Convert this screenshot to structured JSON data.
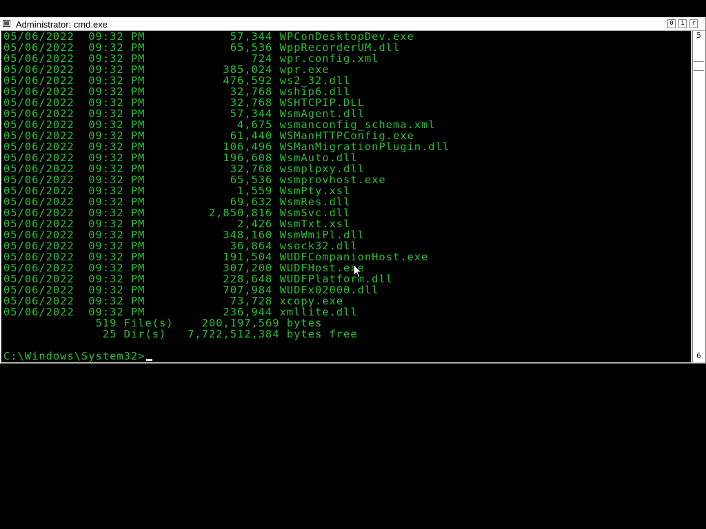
{
  "window": {
    "title": "Administrator: cmd.exe",
    "buttons": {
      "minimize": "0",
      "maximize": "1",
      "close": "r"
    }
  },
  "scrollbar": {
    "up_arrow": "5",
    "down_arrow": "6"
  },
  "console": {
    "text_color": "#25c230",
    "background_color": "#000000",
    "lines": [
      "05/06/2022  09:32 PM            57,344 WPConDesktopDev.exe",
      "05/06/2022  09:32 PM            65,536 WppRecorderUM.dll",
      "05/06/2022  09:32 PM               724 wpr.config.xml",
      "05/06/2022  09:32 PM           385,024 wpr.exe",
      "05/06/2022  09:32 PM           476,592 ws2_32.dll",
      "05/06/2022  09:32 PM            32,768 wship6.dll",
      "05/06/2022  09:32 PM            32,768 WSHTCPIP.DLL",
      "05/06/2022  09:32 PM            57,344 WsmAgent.dll",
      "05/06/2022  09:32 PM             4,675 wsmanconfig_schema.xml",
      "05/06/2022  09:32 PM            61,440 WSManHTTPConfig.exe",
      "05/06/2022  09:32 PM           106,496 WSManMigrationPlugin.dll",
      "05/06/2022  09:32 PM           196,608 WsmAuto.dll",
      "05/06/2022  09:32 PM            32,768 wsmplpxy.dll",
      "05/06/2022  09:32 PM            65,536 wsmprovhost.exe",
      "05/06/2022  09:32 PM             1,559 WsmPty.xsl",
      "05/06/2022  09:32 PM            69,632 WsmRes.dll",
      "05/06/2022  09:32 PM         2,850,816 WsmSvc.dll",
      "05/06/2022  09:32 PM             2,426 WsmTxt.xsl",
      "05/06/2022  09:32 PM           348,160 WsmWmiPl.dll",
      "05/06/2022  09:32 PM            36,864 wsock32.dll",
      "05/06/2022  09:32 PM           191,504 WUDFCompanionHost.exe",
      "05/06/2022  09:32 PM           307,200 WUDFHost.exe",
      "05/06/2022  09:32 PM           228,648 WUDFPlatform.dll",
      "05/06/2022  09:32 PM           707,984 WUDFx02000.dll",
      "05/06/2022  09:32 PM            73,728 xcopy.exe",
      "05/06/2022  09:32 PM           236,944 xmllite.dll",
      "             519 File(s)    200,197,569 bytes",
      "              25 Dir(s)   7,722,512,384 bytes free",
      ""
    ],
    "prompt": "C:\\Windows\\System32>"
  }
}
